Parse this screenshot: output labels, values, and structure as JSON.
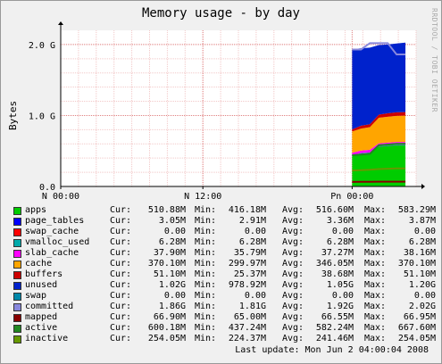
{
  "chart_data": {
    "type": "area",
    "title": "Memory usage - by day",
    "ylabel": "Bytes",
    "ylim": [
      0,
      2200000000
    ],
    "yticks": [
      {
        "value": 0,
        "label": "0.0"
      },
      {
        "value": 1000000000,
        "label": "1.0 G"
      },
      {
        "value": 2000000000,
        "label": "2.0 G"
      }
    ],
    "x_range": [
      0,
      1
    ],
    "xticks": [
      {
        "pos": 0.0,
        "label": "N 00:00"
      },
      {
        "pos": 0.4,
        "label": "N 12:00"
      },
      {
        "pos": 0.82,
        "label": "Pn 00:00"
      }
    ],
    "data_x": [
      0.82,
      0.845,
      0.87,
      0.895,
      0.92,
      0.945,
      0.97
    ],
    "series": [
      {
        "name": "apps",
        "color": "#00cc00",
        "values": [
          430000000,
          460000000,
          470000000,
          560000000,
          570000000,
          580000000,
          580000000
        ]
      },
      {
        "name": "page_tables",
        "color": "#0000ff",
        "values": [
          3050000,
          3050000,
          3050000,
          3050000,
          3050000,
          3050000,
          3050000
        ]
      },
      {
        "name": "swap_cache",
        "color": "#ff0000",
        "values": [
          0,
          0,
          0,
          0,
          0,
          0,
          0
        ]
      },
      {
        "name": "vmalloc_used",
        "color": "#00aaaa",
        "values": [
          6280000,
          6280000,
          6280000,
          6280000,
          6280000,
          6280000,
          6280000
        ]
      },
      {
        "name": "slab_cache",
        "color": "#ff00ff",
        "values": [
          36000000,
          37000000,
          37000000,
          38000000,
          38000000,
          38000000,
          38000000
        ]
      },
      {
        "name": "cache",
        "color": "#ffa500",
        "values": [
          300000000,
          310000000,
          320000000,
          360000000,
          365000000,
          368000000,
          370000000
        ]
      },
      {
        "name": "buffers",
        "color": "#cc0000",
        "values": [
          27000000,
          40000000,
          40000000,
          45000000,
          48000000,
          50000000,
          51000000
        ]
      },
      {
        "name": "unused",
        "color": "#0022cc",
        "values": [
          1130000000,
          1090000000,
          1080000000,
          980000000,
          970000000,
          970000000,
          979000000
        ]
      },
      {
        "name": "swap",
        "color": "#0088aa",
        "values": [
          0,
          0,
          0,
          0,
          0,
          0,
          0
        ]
      }
    ],
    "lines": [
      {
        "name": "committed",
        "color": "#8888dd",
        "values": [
          1930000000,
          1930000000,
          2020000000,
          2020000000,
          2020000000,
          1860000000,
          1860000000
        ]
      },
      {
        "name": "mapped",
        "color": "#880000",
        "values": [
          65000000,
          66000000,
          66000000,
          67000000,
          67000000,
          67000000,
          67000000
        ]
      },
      {
        "name": "active",
        "color": "#228822",
        "values": [
          440000000,
          450000000,
          460000000,
          580000000,
          590000000,
          600000000,
          600000000
        ]
      },
      {
        "name": "inactive",
        "color": "#669900",
        "values": [
          225000000,
          230000000,
          235000000,
          245000000,
          250000000,
          254000000,
          254000000
        ]
      }
    ]
  },
  "legend": [
    {
      "name": "apps",
      "color": "#00cc00",
      "cur": "510.88M",
      "min": "416.18M",
      "avg": "516.60M",
      "max": "583.29M"
    },
    {
      "name": "page_tables",
      "color": "#0000ff",
      "cur": "3.05M",
      "min": "2.91M",
      "avg": "3.36M",
      "max": "3.87M"
    },
    {
      "name": "swap_cache",
      "color": "#ff0000",
      "cur": "0.00",
      "min": "0.00",
      "avg": "0.00",
      "max": "0.00"
    },
    {
      "name": "vmalloc_used",
      "color": "#00aaaa",
      "cur": "6.28M",
      "min": "6.28M",
      "avg": "6.28M",
      "max": "6.28M"
    },
    {
      "name": "slab_cache",
      "color": "#ff00ff",
      "cur": "37.90M",
      "min": "35.79M",
      "avg": "37.27M",
      "max": "38.16M"
    },
    {
      "name": "cache",
      "color": "#ffa500",
      "cur": "370.10M",
      "min": "299.97M",
      "avg": "346.05M",
      "max": "370.10M"
    },
    {
      "name": "buffers",
      "color": "#cc0000",
      "cur": "51.10M",
      "min": "25.37M",
      "avg": "38.68M",
      "max": "51.10M"
    },
    {
      "name": "unused",
      "color": "#0022cc",
      "cur": "1.02G",
      "min": "978.92M",
      "avg": "1.05G",
      "max": "1.20G"
    },
    {
      "name": "swap",
      "color": "#0088aa",
      "cur": "0.00",
      "min": "0.00",
      "avg": "0.00",
      "max": "0.00"
    },
    {
      "name": "committed",
      "color": "#8888dd",
      "cur": "1.86G",
      "min": "1.81G",
      "avg": "1.92G",
      "max": "2.02G"
    },
    {
      "name": "mapped",
      "color": "#880000",
      "cur": "66.90M",
      "min": "65.00M",
      "avg": "66.55M",
      "max": "66.95M"
    },
    {
      "name": "active",
      "color": "#228822",
      "cur": "600.18M",
      "min": "437.24M",
      "avg": "582.24M",
      "max": "667.60M"
    },
    {
      "name": "inactive",
      "color": "#669900",
      "cur": "254.05M",
      "min": "224.37M",
      "avg": "241.46M",
      "max": "254.05M"
    }
  ],
  "labels": {
    "cur": "Cur:",
    "min": "Min:",
    "avg": "Avg:",
    "max": "Max:"
  },
  "watermark": "RRDTOOL / TOBI OETIKER",
  "last_update": "Last update:  Mon Jun  2 04:00:04 2008"
}
